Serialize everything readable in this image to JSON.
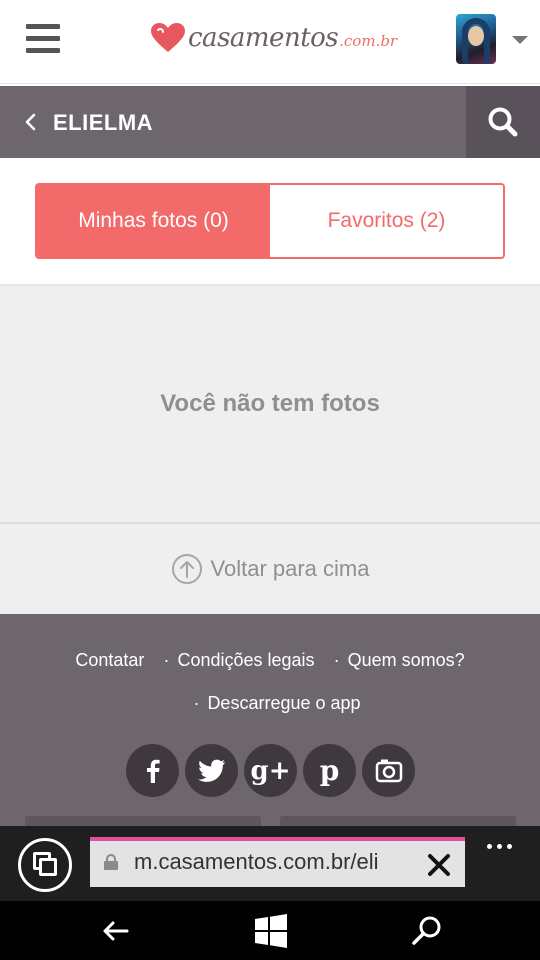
{
  "header": {
    "logo_text": "casamentos",
    "logo_tld": ".com.br",
    "menu_icon": "hamburger-icon",
    "avatar_icon": "user-avatar",
    "caret_icon": "caret-down-icon"
  },
  "titlebar": {
    "title": "ELIELMA",
    "back_icon": "chevron-left-icon",
    "search_icon": "search-icon"
  },
  "tabs": [
    {
      "label": "Minhas fotos (0)",
      "active": true
    },
    {
      "label": "Favoritos (2)",
      "active": false
    }
  ],
  "empty_state": {
    "message": "Você não tem fotos"
  },
  "back_to_top": {
    "label": "Voltar para cima",
    "icon": "arrow-up-circle-icon"
  },
  "footer": {
    "links": [
      "Contatar",
      "Condições legais",
      "Quem somos?",
      "Descarregue o app"
    ],
    "social": [
      "facebook-icon",
      "twitter-icon",
      "google-plus-icon",
      "pinterest-icon",
      "instagram-icon"
    ]
  },
  "browser": {
    "url": "m.casamentos.com.br/eli",
    "tabs_icon": "tabs-icon",
    "lock_icon": "lock-icon",
    "clear_icon": "close-icon",
    "more_icon": "more-icon"
  },
  "os_nav": {
    "back_icon": "back-arrow-icon",
    "home_icon": "windows-icon",
    "search_icon": "search-icon"
  },
  "colors": {
    "brand": "#f36a6a",
    "titlebar_bg": "#6e666d",
    "search_bg": "#59525a",
    "empty_bg": "#efefef",
    "muted_text": "#8f8f8f",
    "url_accent": "#e0519c"
  }
}
